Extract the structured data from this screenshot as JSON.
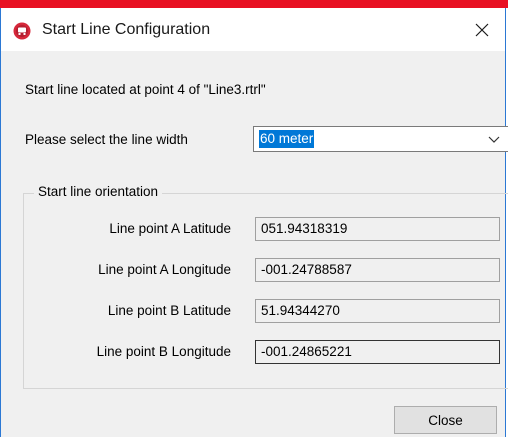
{
  "window": {
    "title": "Start Line Configuration",
    "icon": "red-circle-app-icon",
    "close_icon": "close-icon",
    "title_bar_color": "#ffffff",
    "top_accent_color": "#e81123"
  },
  "info_text": "Start line located at point 4 of \"Line3.rtrl\"",
  "line_width": {
    "label": "Please select the line width",
    "selected": "60 meter"
  },
  "orientation": {
    "legend": "Start line orientation",
    "rows": [
      {
        "label": "Line point A Latitude",
        "value": "051.94318319"
      },
      {
        "label": "Line point A Longitude",
        "value": "-001.24788587"
      },
      {
        "label": "Line point B Latitude",
        "value": "51.94344270"
      },
      {
        "label": "Line point B Longitude",
        "value": "-001.24865221"
      }
    ]
  },
  "buttons": {
    "close_label": "Close"
  }
}
